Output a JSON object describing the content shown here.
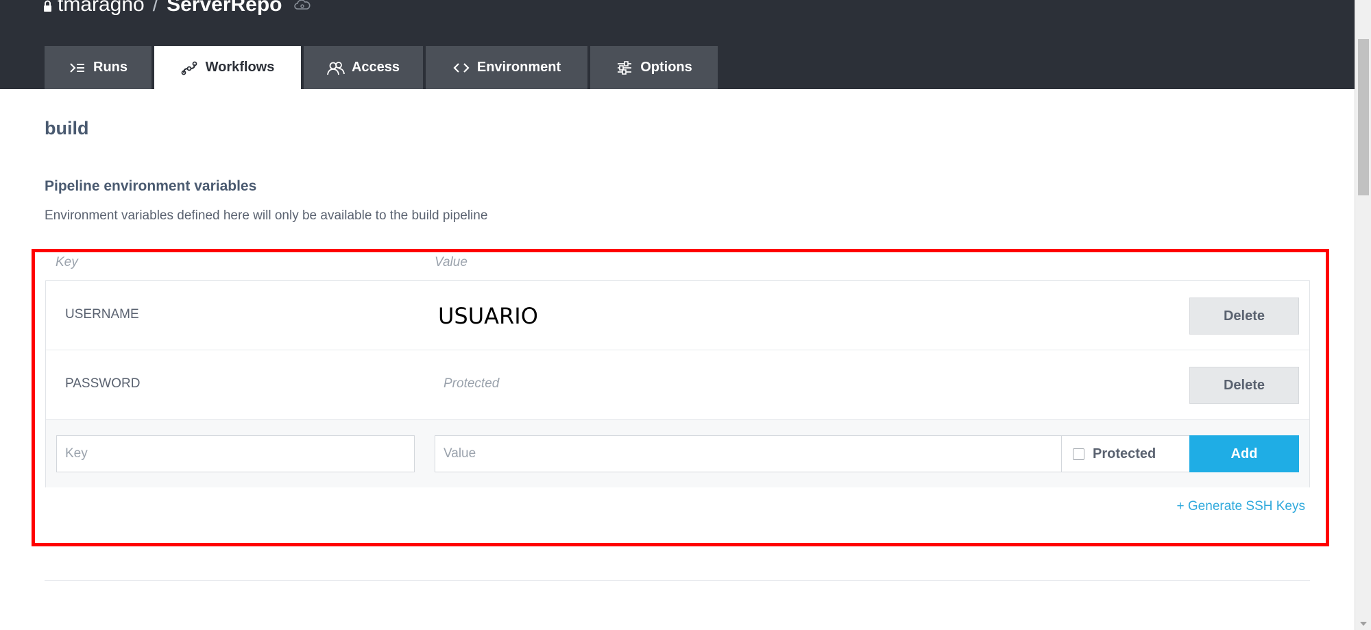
{
  "header": {
    "owner": "tmaragno",
    "separator": "/",
    "repo": "ServerRepo"
  },
  "tabs": [
    {
      "label": "Runs",
      "icon": "terminal-icon",
      "active": false
    },
    {
      "label": "Workflows",
      "icon": "workflow-link-icon",
      "active": true
    },
    {
      "label": "Access",
      "icon": "users-icon",
      "active": false
    },
    {
      "label": "Environment",
      "icon": "code-brackets-icon",
      "active": false
    },
    {
      "label": "Options",
      "icon": "sliders-icon",
      "active": false
    }
  ],
  "main": {
    "section_title": "build",
    "subheading": "Pipeline environment variables",
    "description": "Environment variables defined here will only be available to the build pipeline",
    "columns": {
      "key": "Key",
      "value": "Value"
    },
    "variables": [
      {
        "key": "USERNAME",
        "value": "USUARIO",
        "delete_label": "Delete"
      },
      {
        "key": "PASSWORD",
        "value": "Protected",
        "delete_label": "Delete"
      }
    ],
    "new_variable": {
      "key_placeholder": "Key",
      "value_placeholder": "Value",
      "protected_label": "Protected",
      "protected_checked": false,
      "add_label": "Add"
    },
    "generate_ssh_label": "+ Generate SSH Keys"
  },
  "colors": {
    "header_bg": "#2c3038",
    "tab_bg": "#4b5058",
    "accent": "#1fade5",
    "highlight": "#ff0000",
    "link": "#2fa9dc"
  }
}
